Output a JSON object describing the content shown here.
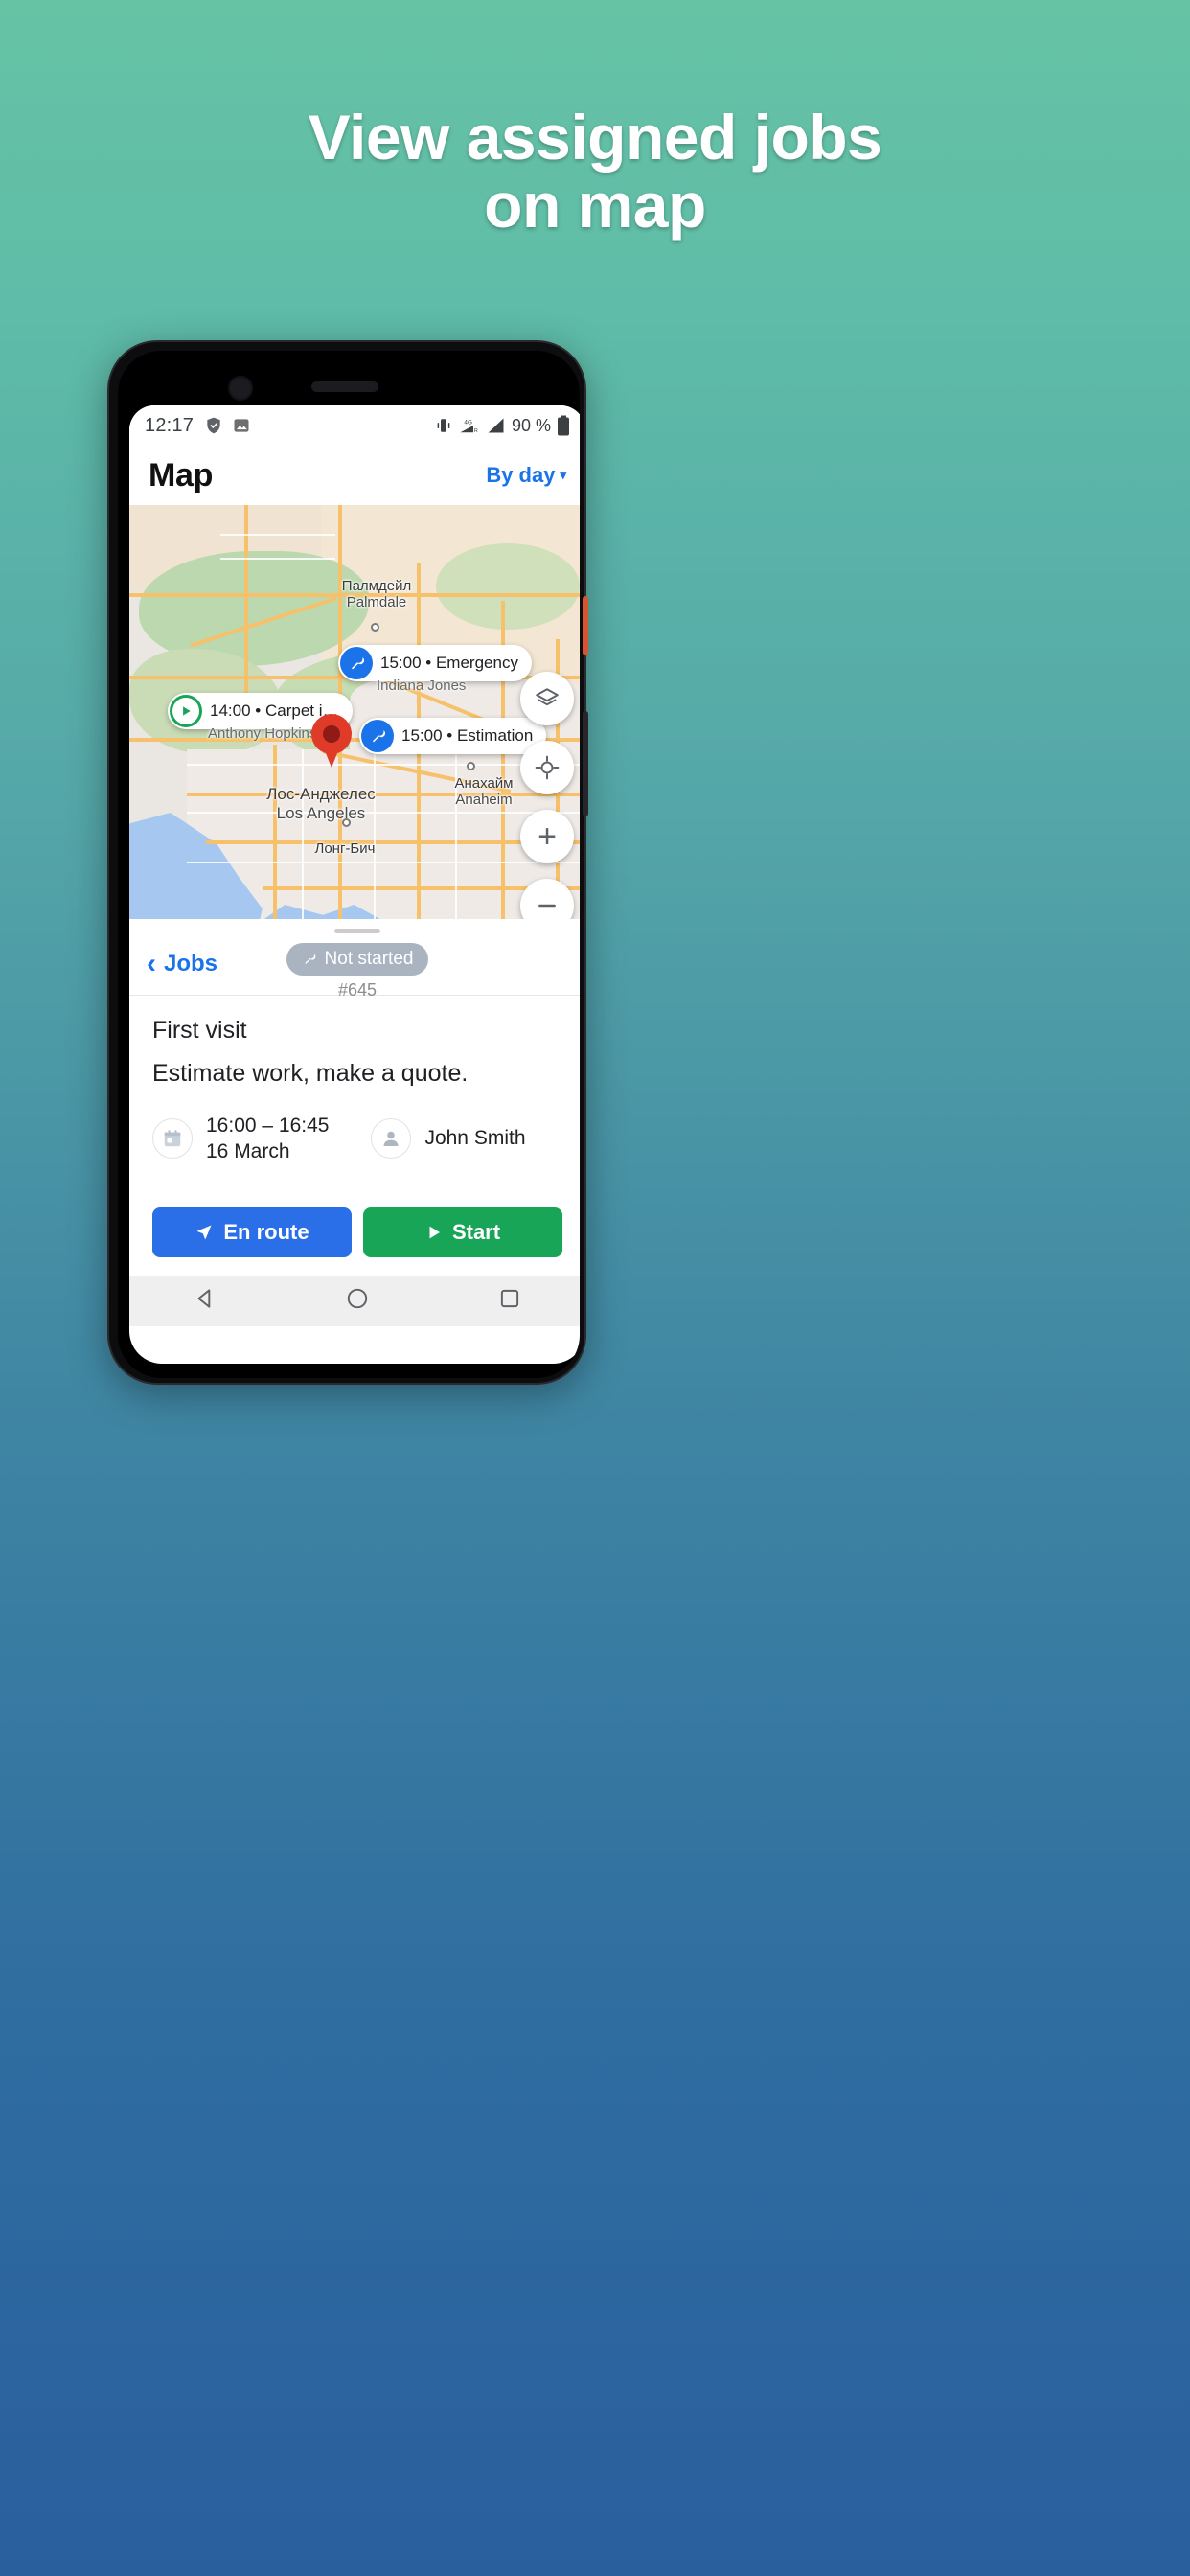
{
  "headline": {
    "line1": "View assigned jobs",
    "line2": "on map"
  },
  "statusbar": {
    "time": "12:17",
    "left_icons": [
      "shield-check-icon",
      "image-icon"
    ],
    "right_icons": [
      "vibrate-icon",
      "signal-4g-icon",
      "signal-bars-icon"
    ],
    "battery": "90 %"
  },
  "appbar": {
    "title": "Map",
    "action_label": "By day",
    "caret": "▾"
  },
  "map": {
    "place_labels": [
      {
        "ru": "Палмдейл",
        "en": "Palmdale"
      },
      {
        "ru": "Лос-Анджелес",
        "en": "Los Angeles"
      },
      {
        "ru": "Анахайм",
        "en": "Anaheim"
      },
      {
        "ru": "Лонг-Бич",
        "en": ""
      }
    ],
    "job_markers": [
      {
        "time": "15:00",
        "type": "Emergency",
        "person": "Indiana Jones",
        "icon": "wrench-icon",
        "color": "#1a73e8"
      },
      {
        "time": "14:00",
        "type": "Carpet i…",
        "person": "Anthony Hopkins",
        "icon": "play-icon",
        "color": "#18a558"
      },
      {
        "time": "15:00",
        "type": "Estimation",
        "person": "",
        "icon": "wrench-icon",
        "color": "#1a73e8"
      }
    ],
    "separator": "•",
    "controls": [
      "layers-icon",
      "my-location-icon",
      "zoom-in-icon",
      "zoom-out-icon"
    ],
    "zoom_in_label": "+",
    "selected_pin": "selected-job-pin"
  },
  "sheet": {
    "back_label": "Jobs",
    "status_label": "Not started",
    "status_icon": "wrench-icon",
    "job_number": "#645",
    "visit_title": "First visit",
    "visit_description": "Estimate work, make a quote.",
    "time_range": "16:00 – 16:45",
    "date": "16 March",
    "assignee": "John Smith",
    "buttons": [
      {
        "label": "En route",
        "icon": "navigation-icon",
        "color": "#2a6ee8"
      },
      {
        "label": "Start",
        "icon": "play-icon",
        "color": "#18a558"
      }
    ]
  },
  "navbar": {
    "back": "back-triangle-icon",
    "home": "home-circle-icon",
    "recents": "recents-square-icon"
  }
}
